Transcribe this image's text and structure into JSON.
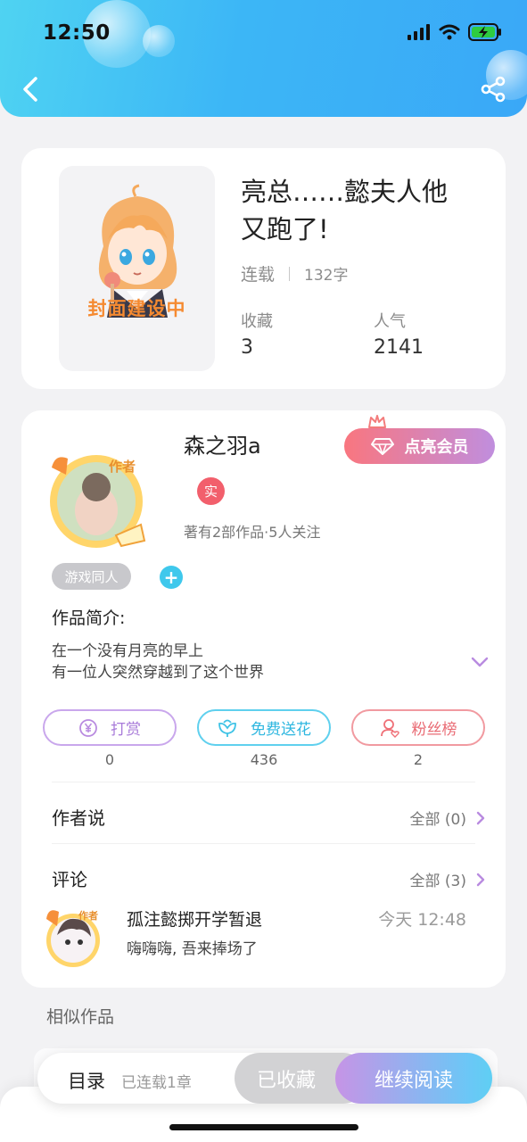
{
  "status_bar": {
    "time": "12:50"
  },
  "book": {
    "cover_text": "封面建设中",
    "title": "亮总……懿夫人他又跑了!",
    "status": "连载",
    "words": "132字",
    "favorites_label": "收藏",
    "favorites": "3",
    "popularity_label": "人气",
    "popularity": "2141"
  },
  "author": {
    "avatar_badge": "作者",
    "name": "森之羽a",
    "vip_label": "点亮会员",
    "verified_badge": "实",
    "works_info": "著有2部作品·5人关注"
  },
  "tags": [
    "游戏同人"
  ],
  "intro": {
    "label": "作品简介:",
    "lines": [
      "在一个没有月亮的早上",
      "有一位人突然穿越到了这个世界"
    ]
  },
  "actions": [
    {
      "label": "打赏",
      "count": "0",
      "color": "#b98be0",
      "icon": "yen-icon"
    },
    {
      "label": "免费送花",
      "count": "436",
      "color": "#3fc3e6",
      "icon": "flower-icon"
    },
    {
      "label": "粉丝榜",
      "count": "2",
      "color": "#ef7077",
      "icon": "fan-icon"
    }
  ],
  "author_says": {
    "label": "作者说",
    "link": "全部 (0)"
  },
  "comments": {
    "label": "评论",
    "link": "全部 (3)",
    "items": [
      {
        "avatar_badge": "作者",
        "name": "孤注懿掷开学暂退",
        "time": "今天 12:48",
        "text": "嗨嗨嗨, 吾来捧场了"
      }
    ]
  },
  "similar_label": "相似作品",
  "bottom_bar": {
    "toc_label": "目录",
    "chapters_info": "已连载1章",
    "favorited_label": "已收藏",
    "continue_label": "继续阅读"
  },
  "colors": {
    "header": "#3cb6f6",
    "accent_orange": "#f58a31",
    "vip_from": "#f9767f",
    "vip_to": "#c08ede"
  }
}
